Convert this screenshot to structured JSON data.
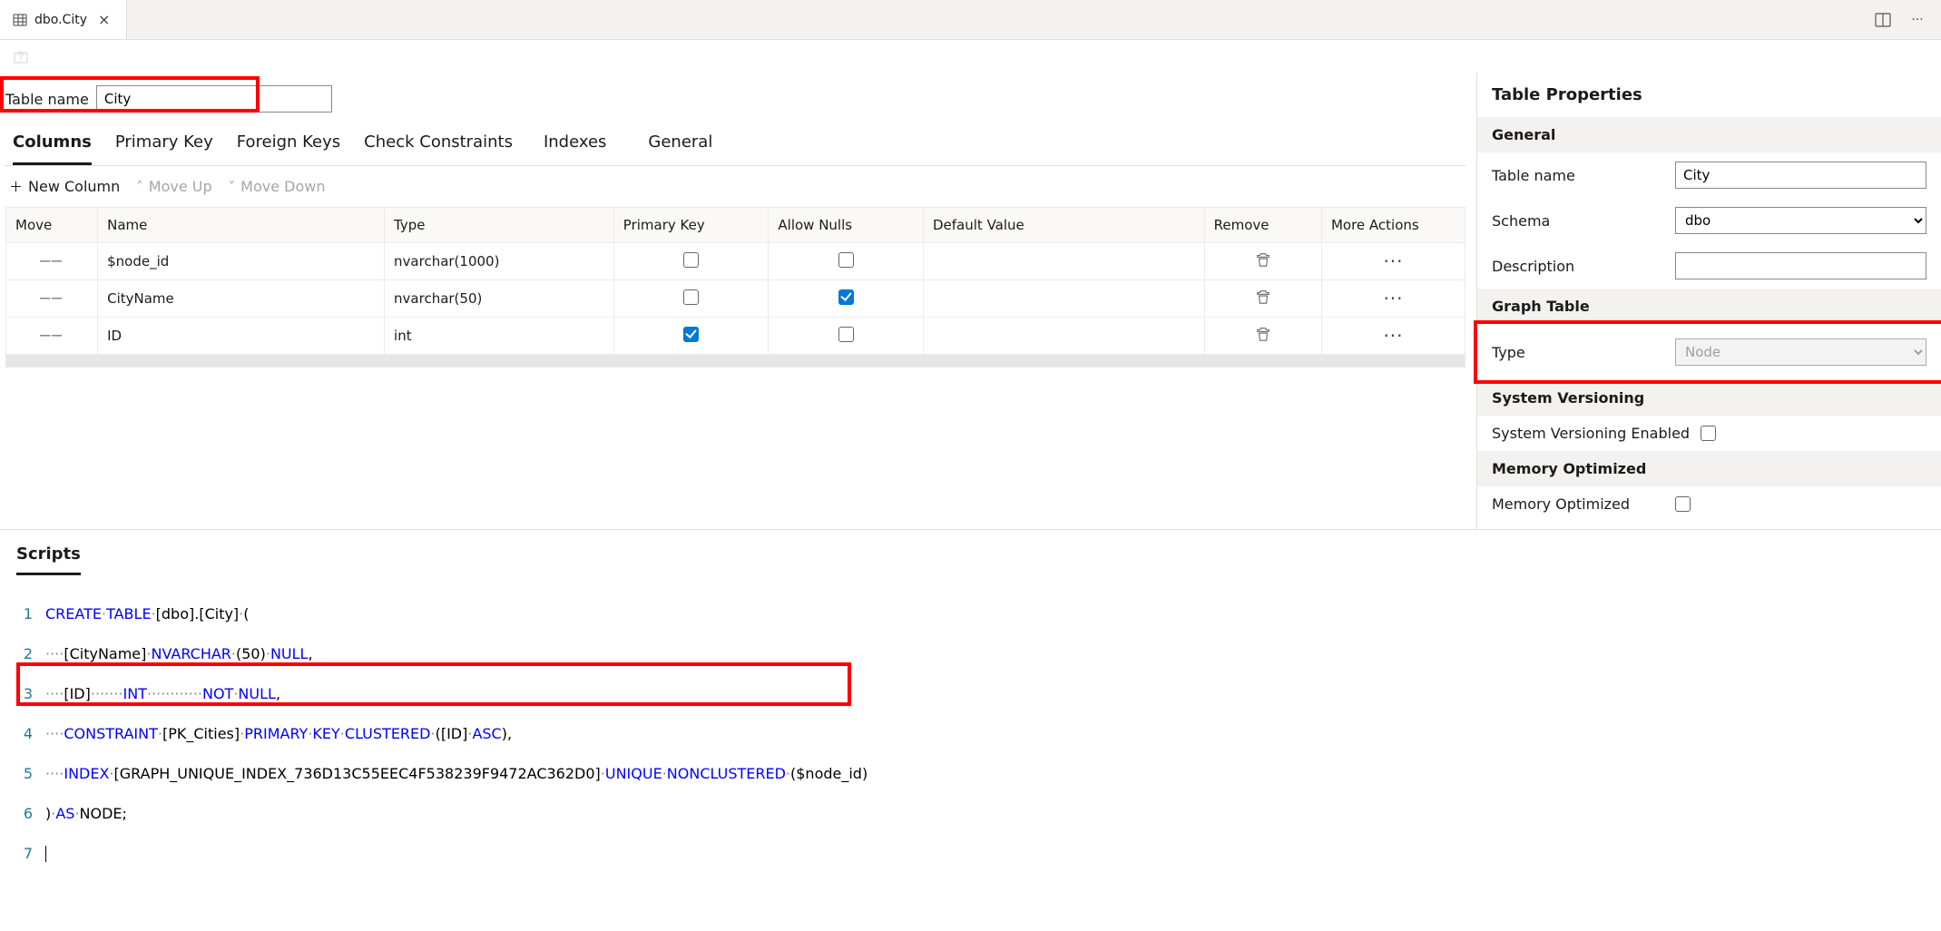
{
  "tab": {
    "title": "dbo.City"
  },
  "tableName": {
    "label": "Table name",
    "value": "City"
  },
  "innerTabs": [
    "Columns",
    "Primary Key",
    "Foreign Keys",
    "Check Constraints",
    "Indexes",
    "General"
  ],
  "actions": {
    "newColumn": "New Column",
    "moveUp": "Move Up",
    "moveDown": "Move Down"
  },
  "gridHeaders": {
    "move": "Move",
    "name": "Name",
    "type": "Type",
    "pk": "Primary Key",
    "an": "Allow Nulls",
    "def": "Default Value",
    "rem": "Remove",
    "more": "More Actions"
  },
  "columns": [
    {
      "name": "$node_id",
      "type": "nvarchar(1000)",
      "pk": false,
      "allowNulls": false,
      "default": ""
    },
    {
      "name": "CityName",
      "type": "nvarchar(50)",
      "pk": false,
      "allowNulls": true,
      "default": ""
    },
    {
      "name": "ID",
      "type": "int",
      "pk": true,
      "allowNulls": false,
      "default": ""
    }
  ],
  "rp": {
    "title": "Table Properties",
    "general": {
      "header": "General",
      "tableNameLabel": "Table name",
      "tableNameValue": "City",
      "schemaLabel": "Schema",
      "schemaValue": "dbo",
      "descLabel": "Description",
      "descValue": ""
    },
    "graph": {
      "header": "Graph Table",
      "typeLabel": "Type",
      "typeValue": "Node"
    },
    "sv": {
      "header": "System Versioning",
      "label": "System Versioning Enabled",
      "enabled": false
    },
    "mo": {
      "header": "Memory Optimized",
      "label": "Memory Optimized",
      "enabled": false
    }
  },
  "scripts": {
    "tab": "Scripts",
    "lines": {
      "l1a": "CREATE",
      "l1b": "TABLE",
      "l1c": "[dbo].[City]",
      "l1d": "(",
      "l2a": "[CityName]",
      "l2b": "NVARCHAR",
      "l2c": "(",
      "l2d": "50",
      "l2e": ")",
      "l2f": "NULL",
      "l2g": ",",
      "l3a": "[ID]",
      "l3b": "INT",
      "l3c": "NOT",
      "l3d": "NULL",
      "l3e": ",",
      "l4a": "CONSTRAINT",
      "l4b": "[PK_Cities]",
      "l4c": "PRIMARY",
      "l4d": "KEY",
      "l4e": "CLUSTERED",
      "l4f": "([ID]",
      "l4g": "ASC",
      "l4h": "),",
      "l5a": "INDEX",
      "l5b": "[GRAPH_UNIQUE_INDEX_736D13C55EEC4F538239F9472AC362D0]",
      "l5c": "UNIQUE",
      "l5d": "NONCLUSTERED",
      "l5e": "($node_id)",
      "l6a": ")",
      "l6b": "AS",
      "l6c": "NODE;",
      "g1": "1",
      "g2": "2",
      "g3": "3",
      "g4": "4",
      "g5": "5",
      "g6": "6",
      "g7": "7"
    }
  }
}
